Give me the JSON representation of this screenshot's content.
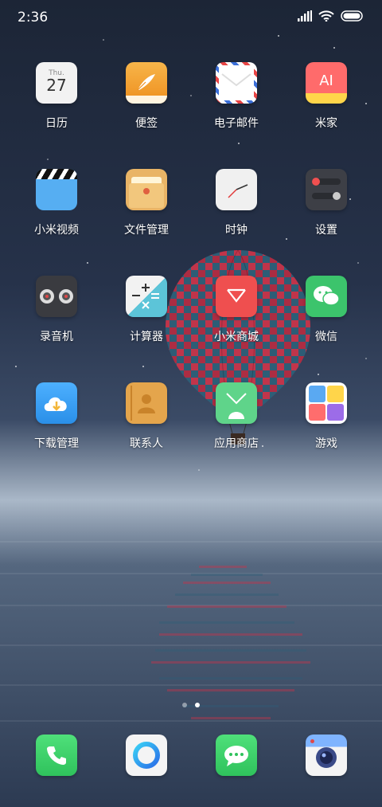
{
  "status_bar": {
    "time": "2:36",
    "icons": [
      "signal-icon",
      "wifi-icon",
      "battery-icon"
    ]
  },
  "apps": [
    {
      "id": "calendar",
      "label": "日历",
      "icon": "calendar-icon",
      "day_abbr": "Thu.",
      "day": "27"
    },
    {
      "id": "notes",
      "label": "便签",
      "icon": "notes-icon"
    },
    {
      "id": "email",
      "label": "电子邮件",
      "icon": "mail-icon"
    },
    {
      "id": "mijia",
      "label": "米家",
      "icon": "mijia-icon",
      "glyph": "AI"
    },
    {
      "id": "video",
      "label": "小米视频",
      "icon": "video-clapper-icon"
    },
    {
      "id": "files",
      "label": "文件管理",
      "icon": "folder-icon"
    },
    {
      "id": "clock",
      "label": "时钟",
      "icon": "clock-icon"
    },
    {
      "id": "settings",
      "label": "设置",
      "icon": "settings-toggle-icon"
    },
    {
      "id": "recorder",
      "label": "录音机",
      "icon": "recorder-icon"
    },
    {
      "id": "calculator",
      "label": "计算器",
      "icon": "calculator-icon"
    },
    {
      "id": "mistore",
      "label": "小米商城",
      "icon": "shopping-bag-icon"
    },
    {
      "id": "wechat",
      "label": "微信",
      "icon": "wechat-icon"
    },
    {
      "id": "downloads",
      "label": "下载管理",
      "icon": "cloud-download-icon"
    },
    {
      "id": "contacts",
      "label": "联系人",
      "icon": "contacts-icon"
    },
    {
      "id": "appstore",
      "label": "应用商店",
      "icon": "app-store-icon"
    },
    {
      "id": "games",
      "label": "游戏",
      "icon": "puzzle-icon"
    }
  ],
  "page_indicator": {
    "pages": 2,
    "current": 2
  },
  "dock": [
    {
      "id": "phone",
      "icon": "phone-icon"
    },
    {
      "id": "browser",
      "icon": "browser-ring-icon"
    },
    {
      "id": "messages",
      "icon": "messages-icon"
    },
    {
      "id": "camera",
      "icon": "camera-icon"
    }
  ],
  "colors": {
    "mistore_red": "#ef4f4f",
    "wechat_green": "#3cc46c",
    "appstore_green": "#5fd48a",
    "phone_green": "#3bd46b",
    "download_blue": "#2a8fe8"
  }
}
